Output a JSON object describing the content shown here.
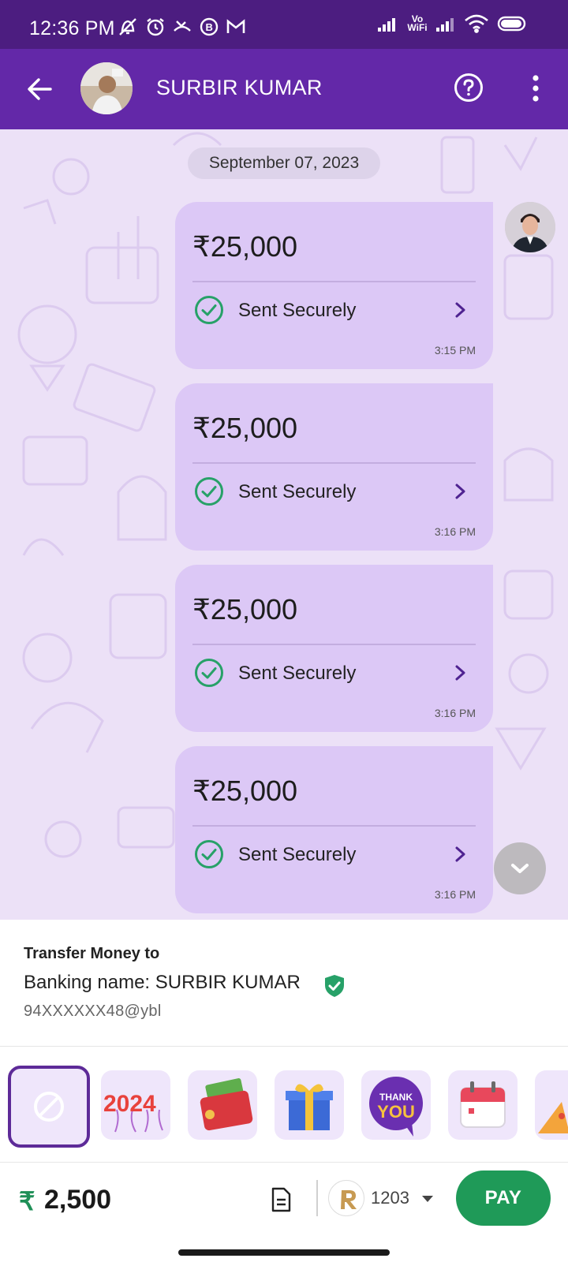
{
  "status_bar": {
    "time": "12:36 PM",
    "network_label": "Vo WiFi"
  },
  "header": {
    "contact_name": "SURBIR KUMAR"
  },
  "chat": {
    "date": "September 07, 2023",
    "messages": [
      {
        "amount": "₹25,000",
        "status": "Sent Securely",
        "time": "3:15 PM"
      },
      {
        "amount": "₹25,000",
        "status": "Sent Securely",
        "time": "3:16 PM"
      },
      {
        "amount": "₹25,000",
        "status": "Sent Securely",
        "time": "3:16 PM"
      },
      {
        "amount": "₹25,000",
        "status": "Sent Securely",
        "time": "3:16 PM"
      }
    ]
  },
  "transfer": {
    "title": "Transfer Money to",
    "banking_name": "Banking name: SURBIR KUMAR",
    "upi_id": "94XXXXXX48@ybl"
  },
  "stickers": {
    "items": [
      {
        "icon": "none-icon",
        "selected": true
      },
      {
        "icon": "new-year-2024-icon",
        "text": "2024"
      },
      {
        "icon": "cash-envelope-icon"
      },
      {
        "icon": "gift-box-icon"
      },
      {
        "icon": "thank-you-bubble-icon",
        "text_line1": "THANK",
        "text_line2": "YOU"
      },
      {
        "icon": "calendar-icon"
      },
      {
        "icon": "party-hat-icon"
      }
    ]
  },
  "payment": {
    "currency_symbol": "₹",
    "amount": "2,500",
    "account_number": "1203",
    "pay_label": "PAY"
  },
  "colors": {
    "status_bar": "#4c1d80",
    "app_bar": "#6328a8",
    "chat_background": "#ece1f7",
    "bubble": "#dcc8f6",
    "success_green": "#27a168",
    "pay_button": "#1f9a58"
  }
}
